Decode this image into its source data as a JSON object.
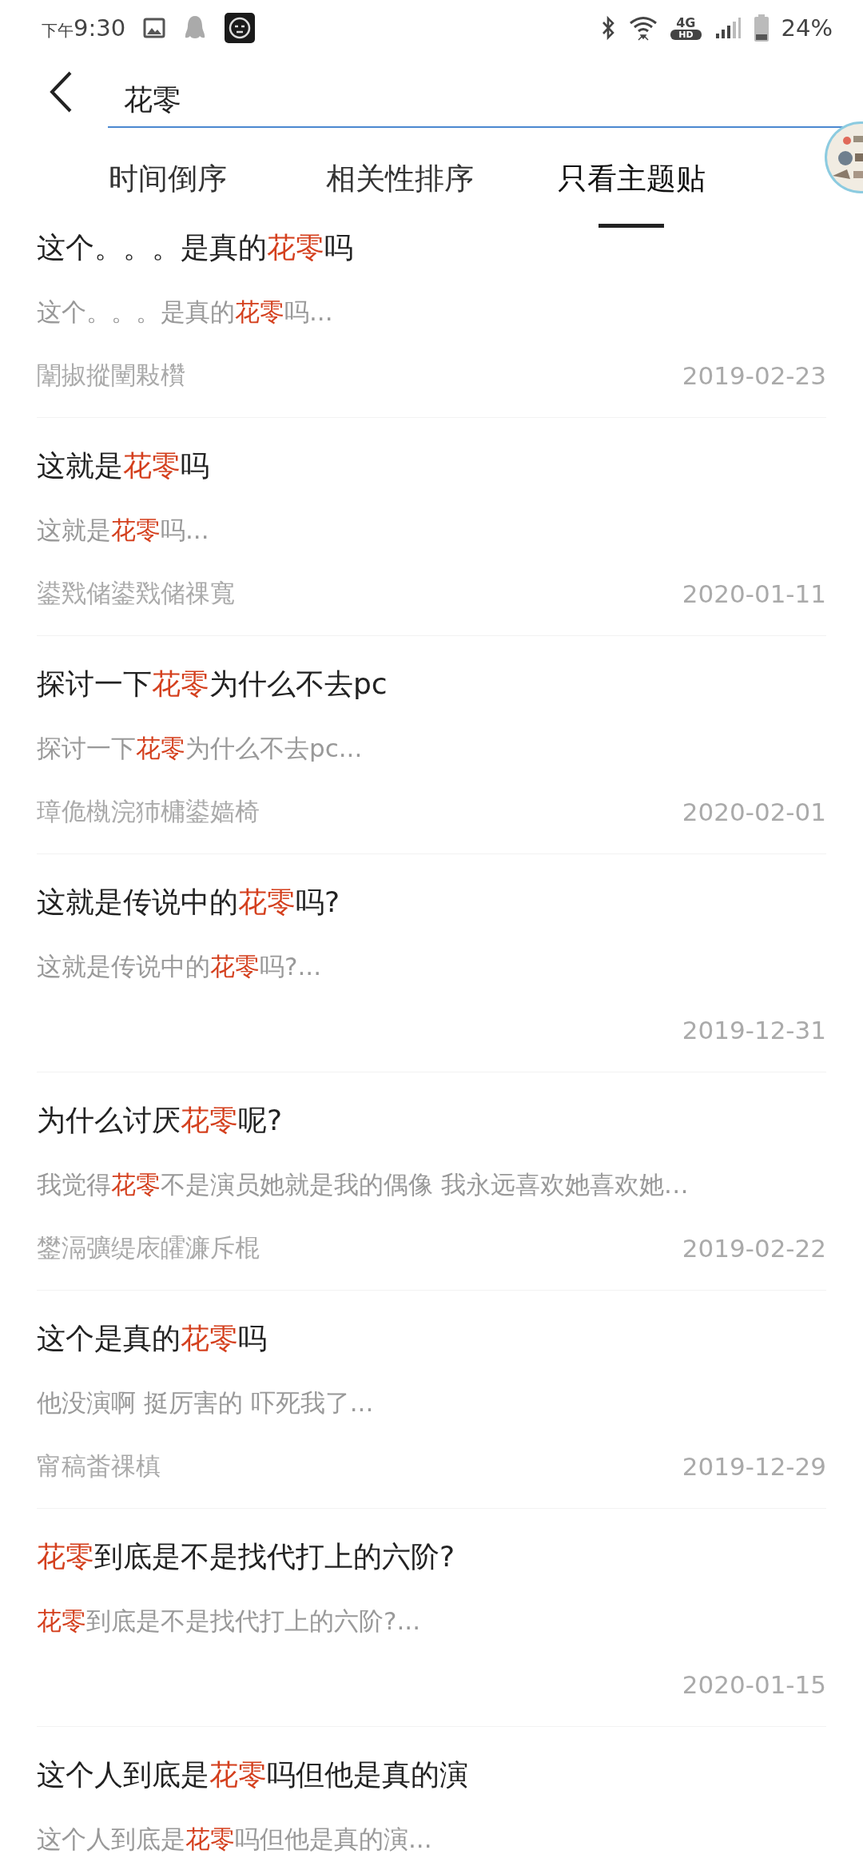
{
  "status_bar": {
    "time_prefix": "下午",
    "time": "9:30",
    "network_top": "4G",
    "network_bottom": "HD",
    "battery": "24%"
  },
  "search": {
    "value": "花零"
  },
  "tabs": [
    {
      "label": "时间倒序",
      "selected": false
    },
    {
      "label": "相关性排序",
      "selected": false
    },
    {
      "label": "只看主题贴",
      "selected": true
    }
  ],
  "results": [
    {
      "title": [
        {
          "text": "这个。。。是真的",
          "kind": "plain"
        },
        {
          "text": "花零",
          "kind": "keyword"
        },
        {
          "text": "吗",
          "kind": "plain"
        }
      ],
      "snippet": [
        {
          "text": "这个。。。是真的",
          "kind": "plain"
        },
        {
          "text": "花零",
          "kind": "keyword"
        },
        {
          "text": "吗...",
          "kind": "plain"
        }
      ],
      "author": "闈掓摐闉敤欑",
      "date": "2019-02-23"
    },
    {
      "title": [
        {
          "text": "这就是",
          "kind": "plain"
        },
        {
          "text": "花零",
          "kind": "keyword"
        },
        {
          "text": "吗",
          "kind": "plain"
        }
      ],
      "snippet": [
        {
          "text": "这就是",
          "kind": "plain"
        },
        {
          "text": "花零",
          "kind": "keyword"
        },
        {
          "text": "吗...",
          "kind": "plain"
        }
      ],
      "author": "鍙戣储鍙戣储祼寬",
      "date": "2020-01-11"
    },
    {
      "title": [
        {
          "text": "探讨一下",
          "kind": "plain"
        },
        {
          "text": "花零",
          "kind": "keyword"
        },
        {
          "text": "为什么不去pc",
          "kind": "plain"
        }
      ],
      "snippet": [
        {
          "text": "探讨一下",
          "kind": "plain"
        },
        {
          "text": "花零",
          "kind": "keyword"
        },
        {
          "text": "为什么不去pc...",
          "kind": "plain"
        }
      ],
      "author": "璋佹槸浣犻槦鍙嫱椅",
      "date": "2020-02-01"
    },
    {
      "title": [
        {
          "text": "这就是传说中的",
          "kind": "plain"
        },
        {
          "text": "花零",
          "kind": "keyword"
        },
        {
          "text": "吗?",
          "kind": "plain"
        }
      ],
      "snippet": [
        {
          "text": "这就是传说中的",
          "kind": "plain"
        },
        {
          "text": "花零",
          "kind": "keyword"
        },
        {
          "text": "吗?...",
          "kind": "plain"
        }
      ],
      "date": "2019-12-31"
    },
    {
      "title": [
        {
          "text": "为什么讨厌",
          "kind": "plain"
        },
        {
          "text": "花零",
          "kind": "keyword"
        },
        {
          "text": "呢?",
          "kind": "plain"
        }
      ],
      "snippet": [
        {
          "text": "我觉得",
          "kind": "plain"
        },
        {
          "text": "花零",
          "kind": "keyword"
        },
        {
          "text": "不是演员她就是我的偶像 我永远喜欢她喜欢她…",
          "kind": "plain"
        }
      ],
      "author": "鐢滆彍缇庡皬濂斥棍",
      "date": "2019-02-22"
    },
    {
      "title": [
        {
          "text": "这个是真的",
          "kind": "plain"
        },
        {
          "text": "花零",
          "kind": "keyword"
        },
        {
          "text": "吗",
          "kind": "plain"
        }
      ],
      "snippet": [
        {
          "text": "他没演啊 挺厉害的 吓死我了...",
          "kind": "plain"
        }
      ],
      "author": "甯稿畨祼槙",
      "date": "2019-12-29"
    },
    {
      "title": [
        {
          "text": "花零",
          "kind": "keyword"
        },
        {
          "text": "到底是不是找代打上的六阶?",
          "kind": "plain"
        }
      ],
      "snippet": [
        {
          "text": "花零",
          "kind": "keyword"
        },
        {
          "text": "到底是不是找代打上的六阶?...",
          "kind": "plain"
        }
      ],
      "date": "2020-01-15"
    },
    {
      "title": [
        {
          "text": "这个人到底是",
          "kind": "plain"
        },
        {
          "text": "花零",
          "kind": "keyword"
        },
        {
          "text": "吗但他是真的演",
          "kind": "plain"
        }
      ],
      "snippet": [
        {
          "text": "这个人到底是",
          "kind": "plain"
        },
        {
          "text": "花零",
          "kind": "keyword"
        },
        {
          "text": "吗但他是真的演...",
          "kind": "plain"
        }
      ]
    }
  ]
}
